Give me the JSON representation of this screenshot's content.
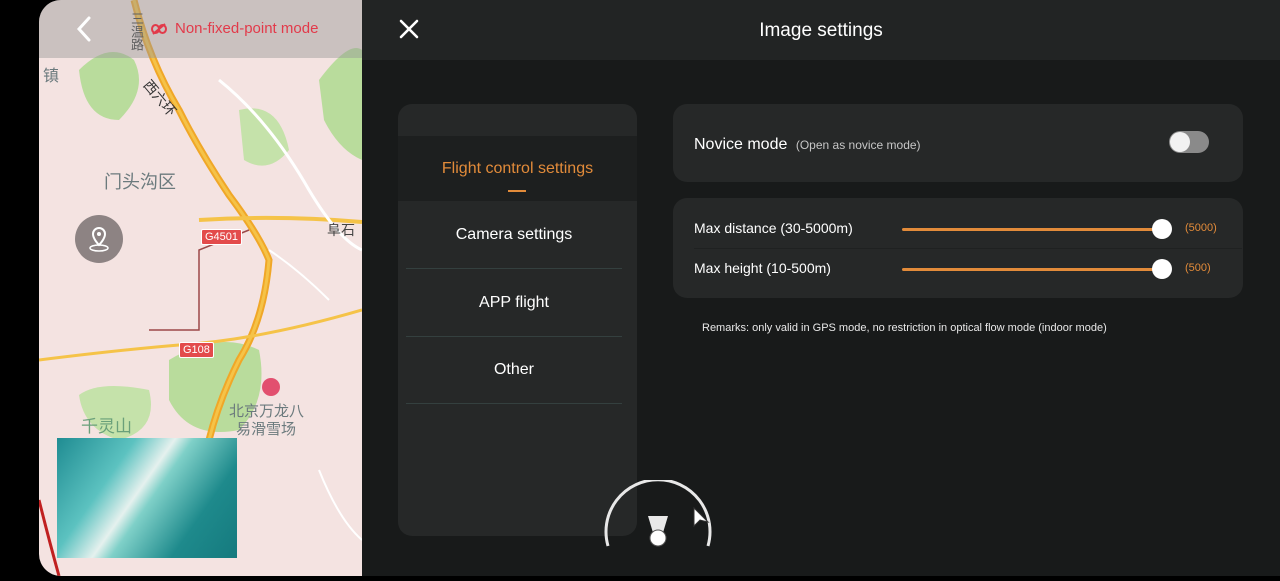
{
  "header": {
    "title": "Image settings"
  },
  "map": {
    "mode_label": "Non-fixed-point mode",
    "labels": [
      "镇",
      "西六环",
      "门头沟区",
      "G4501",
      "阜石",
      "G108",
      "北京万龙八",
      "易滑雪场",
      "千灵山",
      "三温路"
    ]
  },
  "menu": {
    "items": [
      {
        "label": "Flight control settings"
      },
      {
        "label": "Camera settings"
      },
      {
        "label": "APP flight"
      },
      {
        "label": "Other"
      }
    ]
  },
  "novice": {
    "label": "Novice mode",
    "sub": "(Open as novice mode)",
    "enabled": false
  },
  "sliders": [
    {
      "label": "Max distance  (30-5000m)",
      "value_text": "(5000)",
      "value": 5000,
      "min": 30,
      "max": 5000
    },
    {
      "label": "Max height  (10-500m)",
      "value_text": "(500)",
      "value": 500,
      "min": 10,
      "max": 500
    }
  ],
  "remark": "Remarks: only valid in GPS mode, no restriction in optical flow mode (indoor mode)",
  "colors": {
    "accent": "#e28b3a",
    "mode_red": "#e23a4a"
  }
}
